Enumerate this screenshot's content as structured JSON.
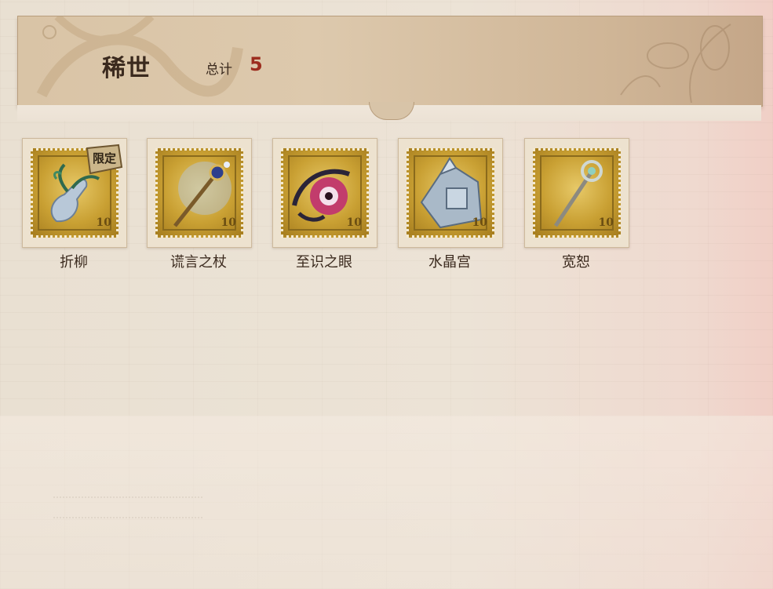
{
  "header": {
    "title": "稀世",
    "total_label": "总计",
    "total_count": "5"
  },
  "items": [
    {
      "name": "折柳",
      "badge": "限定",
      "stamp_value": "10",
      "icon": "vase-icon"
    },
    {
      "name": "谎言之杖",
      "stamp_value": "10",
      "icon": "scepter-icon"
    },
    {
      "name": "至识之眼",
      "stamp_value": "10",
      "icon": "eye-icon"
    },
    {
      "name": "水晶宫",
      "stamp_value": "10",
      "icon": "crystal-palace-icon"
    },
    {
      "name": "宽恕",
      "stamp_value": "10",
      "icon": "staff-icon"
    }
  ],
  "colors": {
    "count": "#9c2c1e",
    "stamp_gold": "#c9a033",
    "header_bg": "#d9c4a6",
    "text": "#3b2a1e"
  }
}
